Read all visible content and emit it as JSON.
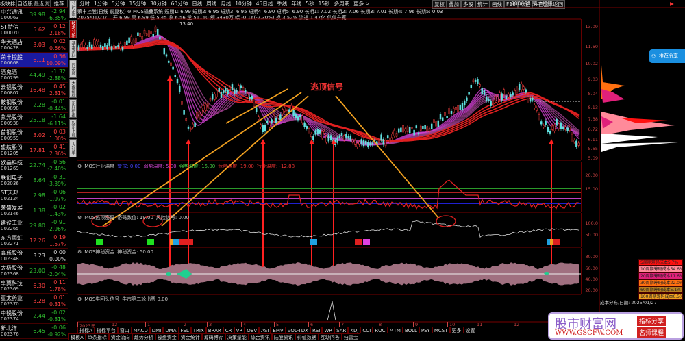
{
  "list": {
    "tabs": [
      "板块排序",
      "自选股",
      "最近浏览",
      "推荐"
    ],
    "rows": [
      {
        "name": "中兴通讯",
        "code": "000063",
        "price": "39.98",
        "chg": "-2.94",
        "pct": "-6.85%",
        "dir": "dn"
      },
      {
        "name": "ST特信",
        "code": "000070",
        "price": "5.62",
        "chg": "0.12",
        "pct": "2.18%",
        "dir": "up"
      },
      {
        "name": "华天酒店",
        "code": "000428",
        "price": "3.03",
        "chg": "0.02",
        "pct": "0.66%",
        "dir": "up"
      },
      {
        "name": "荣丰控股",
        "code": "000668",
        "price": "6.11",
        "chg": "0.56",
        "pct": "10.09%",
        "dir": "up"
      },
      {
        "name": "酒鬼酒",
        "code": "000799",
        "price": "44.49",
        "chg": "-1.32",
        "pct": "-2.88%",
        "dir": "dn"
      },
      {
        "name": "云铝股份",
        "code": "000807",
        "price": "16.48",
        "chg": "0.45",
        "pct": "2.81%",
        "dir": "up"
      },
      {
        "name": "鞍钢股份",
        "code": "000898",
        "price": "2.28",
        "chg": "-0.01",
        "pct": "-0.44%",
        "dir": "dn"
      },
      {
        "name": "紫光股份",
        "code": "000938",
        "price": "25.18",
        "chg": "-1.64",
        "pct": "-6.11%",
        "dir": "dn"
      },
      {
        "name": "首钢股份",
        "code": "000959",
        "price": "3.02",
        "chg": "0.03",
        "pct": "1.00%",
        "dir": "up"
      },
      {
        "name": "盛航股份",
        "code": "001205",
        "price": "17.81",
        "chg": "0.41",
        "pct": "2.36%",
        "dir": "up"
      },
      {
        "name": "欧晶科技",
        "code": "001269",
        "price": "22.74",
        "chg": "-0.56",
        "pct": "-2.40%",
        "dir": "dn"
      },
      {
        "name": "联创电子",
        "code": "002036",
        "price": "8.64",
        "chg": "-0.31",
        "pct": "-3.39%",
        "dir": "dn"
      },
      {
        "name": "ST天邦",
        "code": "002124",
        "price": "2.98",
        "chg": "-0.06",
        "pct": "-1.97%",
        "dir": "dn"
      },
      {
        "name": "荣盛发展",
        "code": "002146",
        "price": "1.38",
        "chg": "-0.02",
        "pct": "-1.43%",
        "dir": "dn"
      },
      {
        "name": "建设工业",
        "code": "002265",
        "price": "29.80",
        "chg": "-0.91",
        "pct": "-2.96%",
        "dir": "dn"
      },
      {
        "name": "东方雨虹",
        "code": "002271",
        "price": "12.26",
        "chg": "0.19",
        "pct": "1.57%",
        "dir": "up"
      },
      {
        "name": "高乐股份",
        "code": "002348",
        "price": "3.23",
        "chg": "0.00",
        "pct": "0.00%",
        "dir": "fl"
      },
      {
        "name": "太极股份",
        "code": "002368",
        "price": "23.00",
        "chg": "-0.48",
        "pct": "-2.04%",
        "dir": "dn"
      },
      {
        "name": "卓翼科技",
        "code": "002369",
        "price": "6.30",
        "chg": "0.11",
        "pct": "1.78%",
        "dir": "up"
      },
      {
        "name": "亚太药业",
        "code": "002370",
        "price": "3.28",
        "chg": "0.01",
        "pct": "0.31%",
        "dir": "up"
      },
      {
        "name": "中锐股份",
        "code": "002374",
        "price": "2.44",
        "chg": "-0.02",
        "pct": "-0.81%",
        "dir": "dn"
      },
      {
        "name": "新北洋",
        "code": "002376",
        "price": "6.45",
        "chg": "-0.06",
        "pct": "-0.92%",
        "dir": "dn"
      }
    ]
  },
  "vtabs": [
    "分时走势",
    "技术分析",
    "基本资料",
    "同花顺F10",
    "大盘指标",
    "东财研报",
    "股东下载",
    "大订单"
  ],
  "toolbar": {
    "periods": [
      "分时",
      "1分钟",
      "5分钟",
      "15分钟",
      "30分钟",
      "60分钟",
      "日线",
      "周线",
      "月线",
      "10分钟",
      "45日线",
      "季线",
      "年线",
      "5秒",
      "15秒",
      "多周期",
      "更多 >"
    ],
    "tools": [
      "复权",
      "叠加",
      "多股",
      "统计",
      "画线",
      "F10",
      "标记",
      "+自选",
      "返回"
    ],
    "stock": "000668 荣丰控股"
  },
  "info": {
    "line1": "荣丰控股(日线 前复权) ⊕ MOS磁叠系统  短期1: 6.99  短期2: 6.95  短期3: 6.95  短期4: 6.90  短期5: 6.90  长期1: 7.02  长期2: 7.06  长期3: 7.01  长期4: 7.96  长期5: 0.03",
    "line2": "2025/01/21/二 开 6.99 高 6.99 低 5.45 收 6.56 量 51160 额 3430万 幅 -0.16(-2.30%) 换 3.52% 流通 1.47亿 估值升宽",
    "high_label": "13.40",
    "low_label": "5.09"
  },
  "price_axis": [
    "13.09",
    "11.60",
    "10.02",
    "9.03",
    "8.04",
    "8.13",
    "7.38",
    "6.72",
    "6.11",
    "5.65",
    "5.09"
  ],
  "annotation": "逃顶信号",
  "ind1": {
    "title": "MOS行业温度",
    "items": [
      "警戒: 0.00",
      "弱势温度: 5.00",
      "强势温度: 15.00",
      "危险温度: 19.00",
      "行业温度: -12.88"
    ],
    "axis": [
      "20.00",
      "15.00"
    ]
  },
  "ind2": {
    "title": "MOS逃顶密码",
    "items": [
      "密码数值: 19.00",
      "风险信号: 0.00"
    ],
    "axis": [
      "100.0",
      "50.00"
    ]
  },
  "ind3": {
    "title": "MOS神秘资金",
    "items": [
      "神秘资金: 50.00"
    ],
    "axis": [
      "80.00",
      "60.00",
      "40.00",
      "20.00"
    ]
  },
  "ind4": {
    "title": "MOS牛回头信号",
    "items": [
      "牛市第二轮出票 0.00"
    ]
  },
  "dates": [
    "2023年",
    "12",
    "1",
    "2",
    "3",
    "4",
    "5",
    "6",
    "7",
    "8",
    "9",
    "10",
    "11",
    "12"
  ],
  "btabs1": [
    "指标A",
    "指标平台",
    "窗口",
    "MACD",
    "DMI",
    "DMA",
    "FSL",
    "TRIX",
    "BRAR",
    "CR",
    "VR",
    "OBV",
    "ASI",
    "EMV",
    "VOL-TDX",
    "RSI",
    "WR",
    "SAR",
    "KDJ",
    "CCI",
    "ROC",
    "MTM",
    "BOLL",
    "PSY",
    "MCST",
    "更多",
    "设置"
  ],
  "btabs2": [
    "模板A",
    "单条指标",
    "资金流向",
    "趋势分析",
    "操盘资金",
    "资金统计",
    "筹码博弈",
    "决策量能",
    "综合资讯",
    "陆股资讯",
    "价值数据",
    "互动问答",
    "扫雷宝"
  ],
  "legend": [
    {
      "t": "5周期筹码成本5.7%",
      "c": "#ff1010"
    },
    {
      "t": "10周期筹码成本54.6%",
      "c": "#ff8a9a"
    },
    {
      "t": "20周期筹码成本11.6%",
      "c": "#e0207a"
    },
    {
      "t": "30周期筹码成本22.0%",
      "c": "#ff7010"
    },
    {
      "t": "60周期筹码成本5.1%",
      "c": "#b88020"
    },
    {
      "t": "100周期筹码成本0.5%",
      "c": "#f0a020"
    }
  ],
  "cost_date": "成本分布,日期: 2025/01/27",
  "share_btn": "推荐分享",
  "watermark": {
    "title": "股市财富网",
    "url": "WWW.GSCFW.COM",
    "tag1": "指标分享",
    "tag2": "名师课程"
  }
}
